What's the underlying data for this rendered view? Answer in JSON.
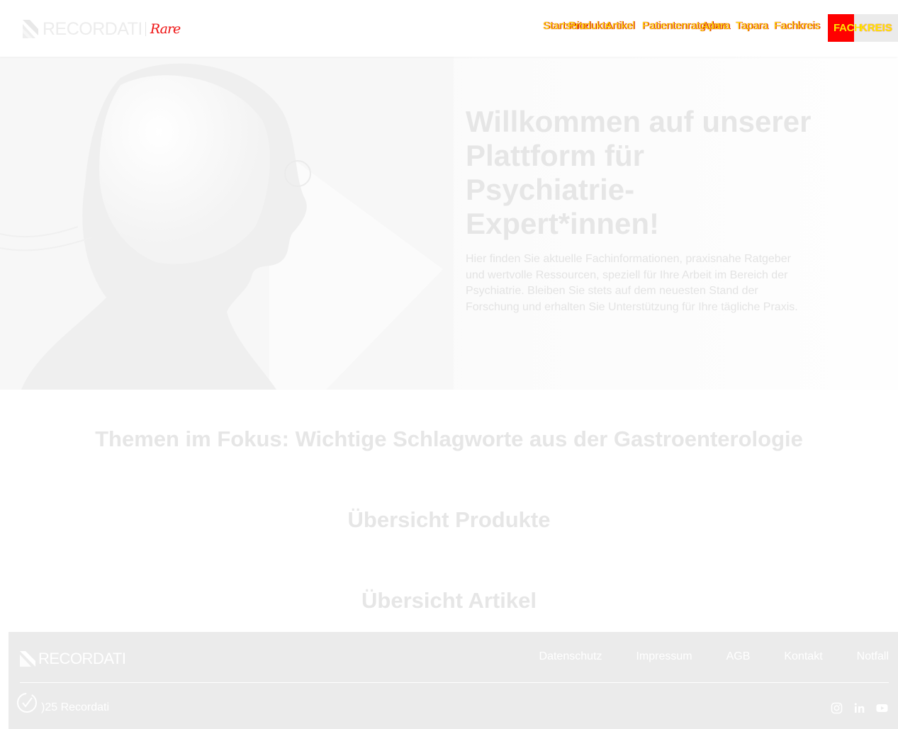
{
  "header": {
    "logo": {
      "wordmark": "RECORDATI",
      "script": "Rare"
    },
    "nav": [
      {
        "label": "Startseite"
      },
      {
        "label": "Produkte"
      },
      {
        "label": "Artikel"
      },
      {
        "label": "Patientenratgeber"
      },
      {
        "label": "Apara"
      },
      {
        "label": "Tapara"
      },
      {
        "label": "Fachkreis"
      }
    ],
    "fach_button": "FACH",
    "secondary_button": "KREIS"
  },
  "hero": {
    "title": "Willkommen auf unserer Plattform für Psychiatrie-Expert*innen!",
    "text": "Hier finden Sie aktuelle Fachinformationen, praxisnahe Ratgeber und wertvolle Ressourcen, speziell für Ihre Arbeit im Bereich der Psychiatrie. Bleiben Sie stets auf dem neuesten Stand der Forschung und erhalten Sie Unterstützung für Ihre tägliche Praxis."
  },
  "sections": {
    "focus_title": "Themen im Fokus: Wichtige Schlagworte aus der Gastroenterologie",
    "products_title": "Übersicht Produkte",
    "articles_title": "Übersicht Artikel"
  },
  "footer": {
    "logo_wordmark": "RECORDATI",
    "links": [
      {
        "label": "Datenschutz"
      },
      {
        "label": "Impressum"
      },
      {
        "label": "AGB"
      },
      {
        "label": "Kontakt"
      },
      {
        "label": "Notfall"
      }
    ],
    "copyright": ")25 Recordati",
    "social_icons": [
      "instagram-icon",
      "linkedin-icon",
      "youtube-icon"
    ]
  },
  "colors": {
    "brand_red": "#ff0000",
    "nav_yellow": "#ffe800",
    "footer_bg": "#ebebeb"
  }
}
